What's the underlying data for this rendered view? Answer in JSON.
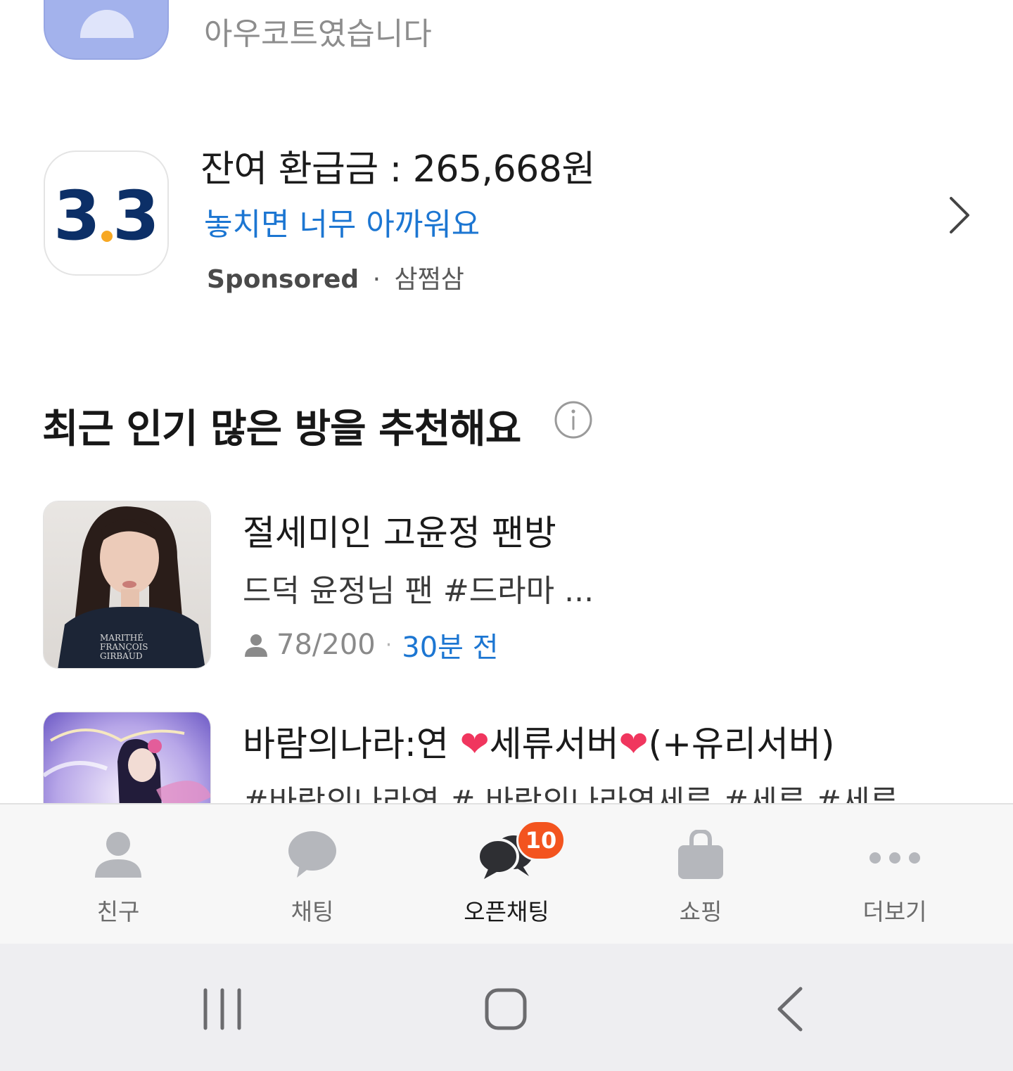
{
  "top_item": {
    "description": "아우코트였습니다"
  },
  "ad": {
    "logo_text": "3.3",
    "title": "잔여 환급금 : 265,668원",
    "subtitle": "놓치면 너무 아까워요",
    "sponsored_label": "Sponsored",
    "separator": "·",
    "advertiser": "삼쩜삼",
    "logo_colors": {
      "navy": "#0c2f67",
      "orange": "#f7a823"
    }
  },
  "section": {
    "title": "최근 인기 많은 방을 추천해요",
    "info_icon": "info-icon"
  },
  "rooms": [
    {
      "name": "절세미인 고윤정 팬방",
      "description": "드덕 윤정님 팬 #드라마 ...",
      "members": "78/200",
      "separator": "·",
      "time": "30분 전"
    },
    {
      "name_prefix": "바람의나라:연 ",
      "heart1": "❤",
      "name_mid": "세류서버",
      "heart2": "❤",
      "name_suffix": "(+유리서버)",
      "description": "#바람의나라연 # 바람의나라연세류 #세류 #세류"
    }
  ],
  "tabbar": {
    "tabs": [
      {
        "label": "친구",
        "icon": "person-icon"
      },
      {
        "label": "채팅",
        "icon": "chat-bubble-icon"
      },
      {
        "label": "오픈채팅",
        "icon": "open-chat-icon",
        "active": true
      },
      {
        "label": "쇼핑",
        "icon": "shopping-bag-icon"
      },
      {
        "label": "더보기",
        "icon": "more-dots-icon"
      }
    ],
    "badge_count": "10",
    "accent_color": "#f3541f"
  },
  "system_nav": {
    "buttons": [
      "recent-apps-icon",
      "home-icon",
      "back-icon"
    ]
  }
}
